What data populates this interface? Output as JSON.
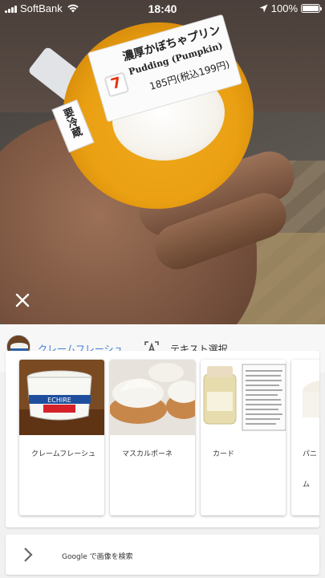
{
  "status_bar": {
    "carrier": "SoftBank",
    "time": "18:40",
    "battery": "100%",
    "battery_level": 1.0
  },
  "photo": {
    "label_title": "濃厚かぼちゃプリン",
    "label_subtitle": "Pudding (Pumpkin)",
    "label_price": "185円(税込199円)",
    "label_storage": "要冷蔵",
    "brand_logo_text": "7"
  },
  "lens": {
    "chip_object_label": "クレームフレーシュ",
    "chip_text_label": "テキスト選択",
    "results": [
      {
        "caption": "クレームフレーシュ",
        "image_text": "ECHIRE"
      },
      {
        "caption": "マスカルポーネ"
      },
      {
        "caption": "カード"
      },
      {
        "caption": "パニ",
        "caption_line2": "ム"
      }
    ],
    "search_label": "Google で画像を検索"
  },
  "colors": {
    "link_blue": "#3b7fd6",
    "panel_bg": "#f1f1f1"
  }
}
